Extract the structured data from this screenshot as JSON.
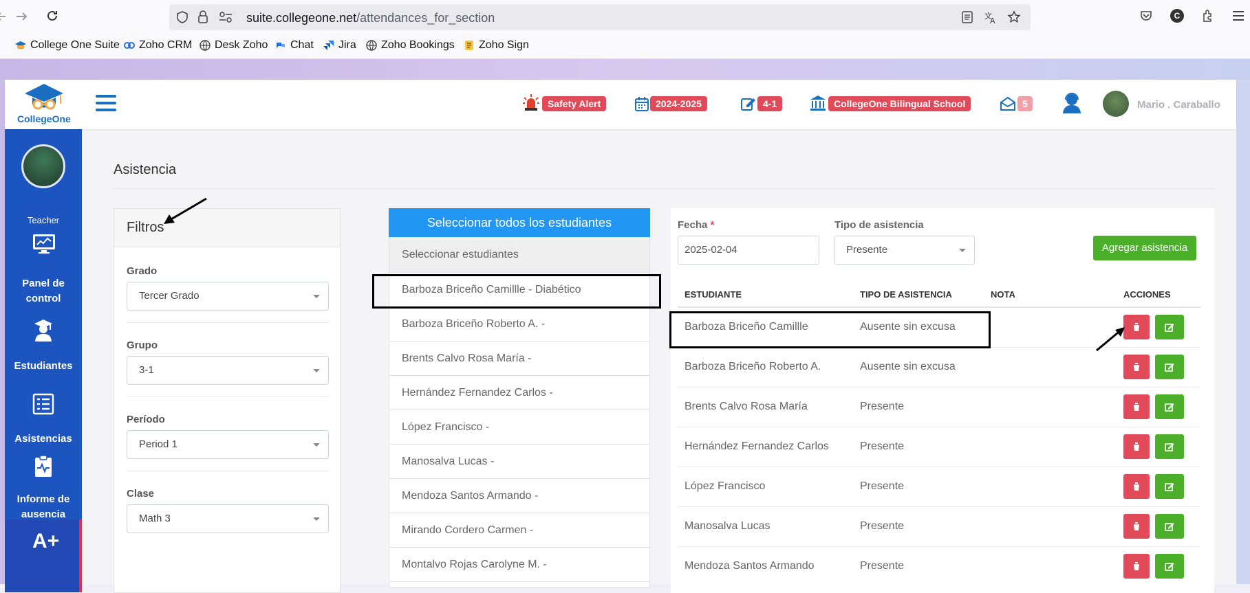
{
  "browser": {
    "url_host": "suite.collegeone.net",
    "url_path": "/attendances_for_section",
    "bookmarks": [
      "College One Suite",
      "Zoho CRM",
      "Desk Zoho",
      "Chat",
      "Jira",
      "Zoho Bookings",
      "Zoho Sign"
    ],
    "avatar_letter": "C"
  },
  "header": {
    "logo_text": "CollegeOne",
    "safety_alert": "Safety Alert",
    "year": "2024-2025",
    "group_badge": "4-1",
    "school": "CollegeOne Bilingual School",
    "messages_count": "5",
    "user_name": "Mario . Caraballo"
  },
  "sidebar": {
    "role": "Teacher",
    "items": [
      {
        "label_line1": "Panel de",
        "label_line2": "control",
        "icon": "dashboard-monitor-icon"
      },
      {
        "label_line1": "Estudiantes",
        "label_line2": "",
        "icon": "graduate-icon"
      },
      {
        "label_line1": "Asistencias",
        "label_line2": "",
        "icon": "attendance-list-icon"
      },
      {
        "label_line1": "Informe de",
        "label_line2": "ausencia",
        "icon": "clipboard-pulse-icon"
      }
    ],
    "grades_icon_text": "A+"
  },
  "page": {
    "title": "Asistencia"
  },
  "filters": {
    "title": "Filtros",
    "grado_label": "Grado",
    "grado_value": "Tercer Grado",
    "grupo_label": "Grupo",
    "grupo_value": "3-1",
    "periodo_label": "Período",
    "periodo_value": "Period 1",
    "clase_label": "Clase",
    "clase_value": "Math 3"
  },
  "students": {
    "select_all": "Seleccionar todos los estudiantes",
    "header": "Seleccionar estudiantes",
    "items": [
      "Barboza Briceño Camillle - Diabético",
      "Barboza Briceño Roberto A. -",
      "Brents Calvo Rosa María -",
      "Hernández Fernandez Carlos -",
      "López Francisco -",
      "Manosalva Lucas -",
      "Mendoza Santos Armando -",
      "Mirando Cordero Carmen -",
      "Montalvo Rojas Carolyne M. -"
    ]
  },
  "attendance": {
    "fecha_label": "Fecha",
    "required_mark": "*",
    "fecha_value": "2025-02-04",
    "tipo_label": "Tipo de asistencia",
    "tipo_value": "Presente",
    "add_button": "Agregar asistencia",
    "columns": [
      "ESTUDIANTE",
      "TIPO DE ASISTENCIA",
      "NOTA",
      "ACCIONES"
    ],
    "rows": [
      {
        "student": "Barboza Briceño Camillle",
        "type": "Ausente sin excusa"
      },
      {
        "student": "Barboza Briceño Roberto A.",
        "type": "Ausente sin excusa"
      },
      {
        "student": "Brents Calvo Rosa María",
        "type": "Presente"
      },
      {
        "student": "Hernández Fernandez Carlos",
        "type": "Presente"
      },
      {
        "student": "López Francisco",
        "type": "Presente"
      },
      {
        "student": "Manosalva Lucas",
        "type": "Presente"
      },
      {
        "student": "Mendoza Santos Armando",
        "type": "Presente"
      }
    ]
  },
  "colors": {
    "primary_blue": "#1c55c0",
    "badge_red": "#e04a59",
    "action_green": "#4caf2a",
    "select_all_blue": "#2196f3"
  }
}
